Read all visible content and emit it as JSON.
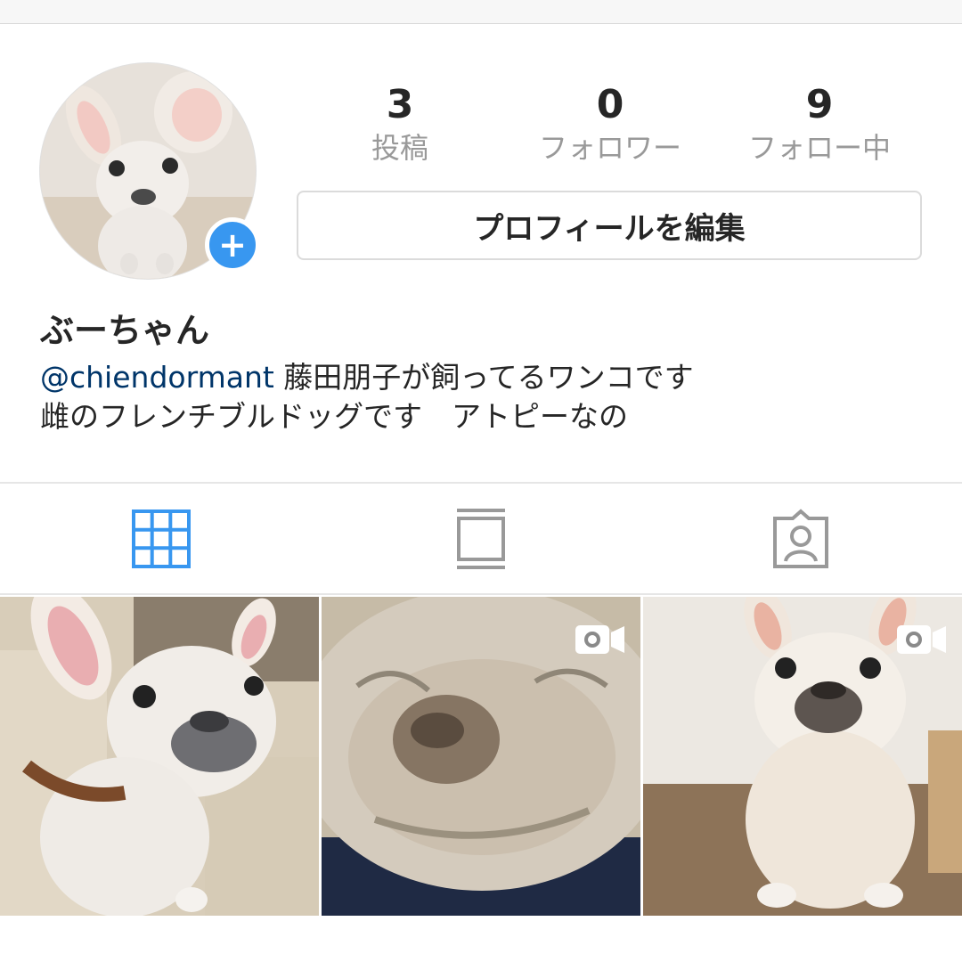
{
  "profile": {
    "username_display": "ぶーちゃん",
    "bio_mention": "@chiendormant",
    "bio_line1_rest": " 藤田朋子が飼ってるワンコです",
    "bio_line2": "雌のフレンチブルドッグです　アトピーなの",
    "avatar_icon": "dog-photo",
    "add_badge_icon": "plus-icon",
    "add_badge_text": "+"
  },
  "stats": [
    {
      "value": "3",
      "label": "投稿"
    },
    {
      "value": "0",
      "label": "フォロワー"
    },
    {
      "value": "9",
      "label": "フォロー中"
    }
  ],
  "edit_profile_label": "プロフィールを編集",
  "tabs": [
    {
      "name": "grid-view",
      "icon": "grid-icon",
      "active": true
    },
    {
      "name": "feed-view",
      "icon": "feed-icon",
      "active": false
    },
    {
      "name": "tagged-view",
      "icon": "tagged-person-icon",
      "active": false
    }
  ],
  "colors": {
    "accent": "#3897f0",
    "mention": "#003569",
    "muted": "#999999",
    "text": "#262626"
  },
  "posts": [
    {
      "type": "photo",
      "icon": null
    },
    {
      "type": "video",
      "icon": "video-camera-icon"
    },
    {
      "type": "video",
      "icon": "video-camera-icon"
    }
  ]
}
